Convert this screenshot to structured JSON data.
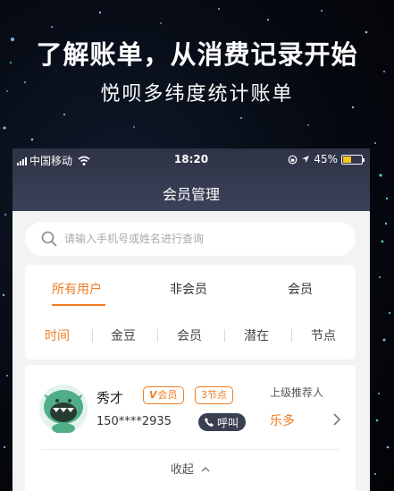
{
  "promo": {
    "headline": "了解账单，从消费记录开始",
    "subline": "悦呗多纬度统计账单"
  },
  "status_bar": {
    "carrier": "中国移动",
    "time": "18:20",
    "battery": "45%",
    "battery_level": 0.45
  },
  "nav": {
    "title": "会员管理"
  },
  "search": {
    "placeholder": "请输入手机号或姓名进行查询",
    "icon": "search-icon"
  },
  "tabs": [
    {
      "label": "所有用户",
      "active": true
    },
    {
      "label": "非会员",
      "active": false
    },
    {
      "label": "会员",
      "active": false
    }
  ],
  "sort_options": [
    {
      "label": "时间",
      "active": true
    },
    {
      "label": "金豆",
      "active": false
    },
    {
      "label": "会员",
      "active": false
    },
    {
      "label": "潜在",
      "active": false
    },
    {
      "label": "节点",
      "active": false
    }
  ],
  "member": {
    "name": "秀才",
    "badge_member_mark": "V",
    "badge_member": "会员",
    "badge_nodes": "3节点",
    "phone": "150****2935",
    "call_label": "呼叫",
    "referrer_label": "上级推荐人",
    "referrer_name": "乐多",
    "avatar": "monster-avatar-icon"
  },
  "collapse_label": "收起",
  "colors": {
    "accent": "#f07d24",
    "nav_bg": "#343a4f",
    "call_button": "#3a3f52"
  }
}
